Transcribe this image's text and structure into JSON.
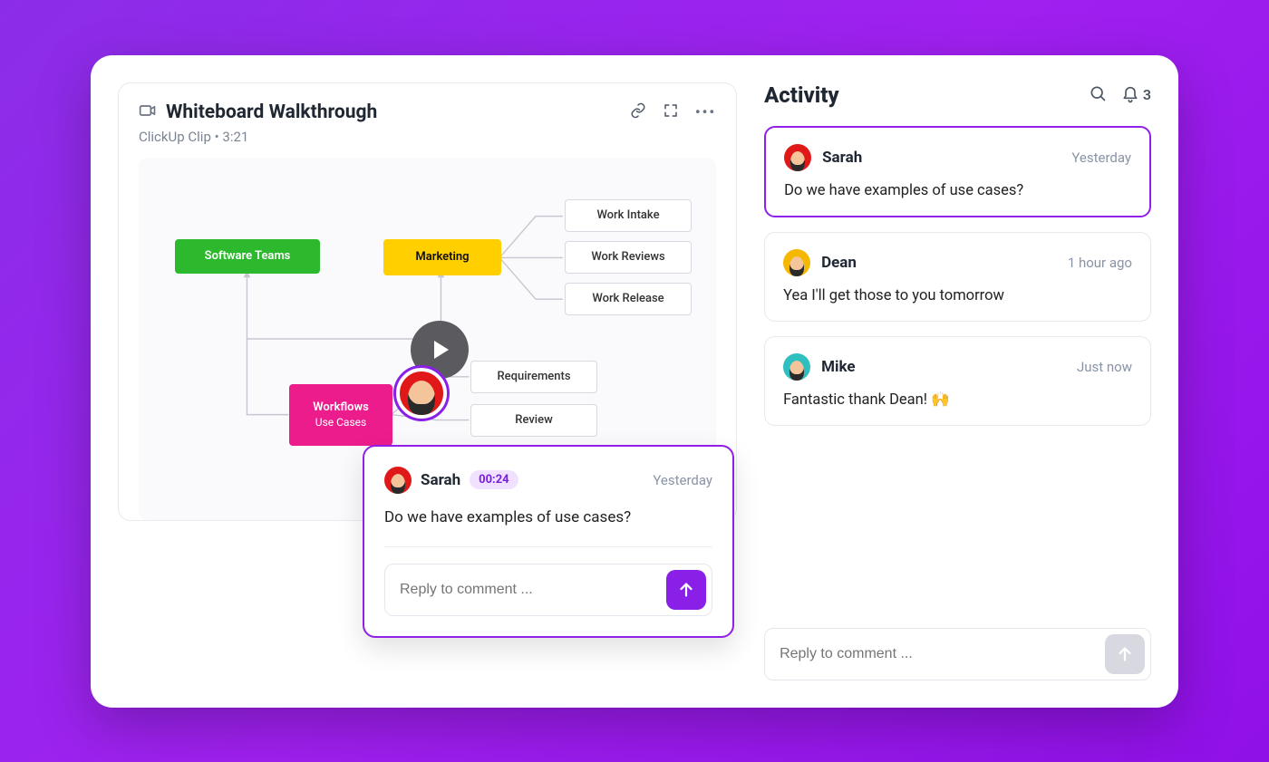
{
  "clip": {
    "title": "Whiteboard Walkthrough",
    "source": "ClickUp Clip",
    "duration": "3:21"
  },
  "diagram": {
    "software_teams": "Software Teams",
    "marketing": "Marketing",
    "work_intake": "Work Intake",
    "work_reviews": "Work Reviews",
    "work_release": "Work Release",
    "requirements": "Requirements",
    "review": "Review",
    "workflows_title": "Workflows",
    "workflows_sub": "Use Cases"
  },
  "popover": {
    "author": "Sarah",
    "timestamp_pill": "00:24",
    "date": "Yesterday",
    "message": "Do we have examples of use cases?",
    "reply_placeholder": "Reply to comment ..."
  },
  "activity": {
    "title": "Activity",
    "notification_count": "3",
    "reply_placeholder": "Reply to comment ...",
    "items": [
      {
        "name": "Sarah",
        "date": "Yesterday",
        "msg": "Do we have examples of use cases?",
        "avatar": "red",
        "selected": true
      },
      {
        "name": "Dean",
        "date": "1 hour ago",
        "msg": "Yea I'll get those to you tomorrow",
        "avatar": "yellow",
        "selected": false
      },
      {
        "name": "Mike",
        "date": "Just now",
        "msg": "Fantastic thank Dean! 🙌",
        "avatar": "teal",
        "selected": false
      }
    ]
  }
}
